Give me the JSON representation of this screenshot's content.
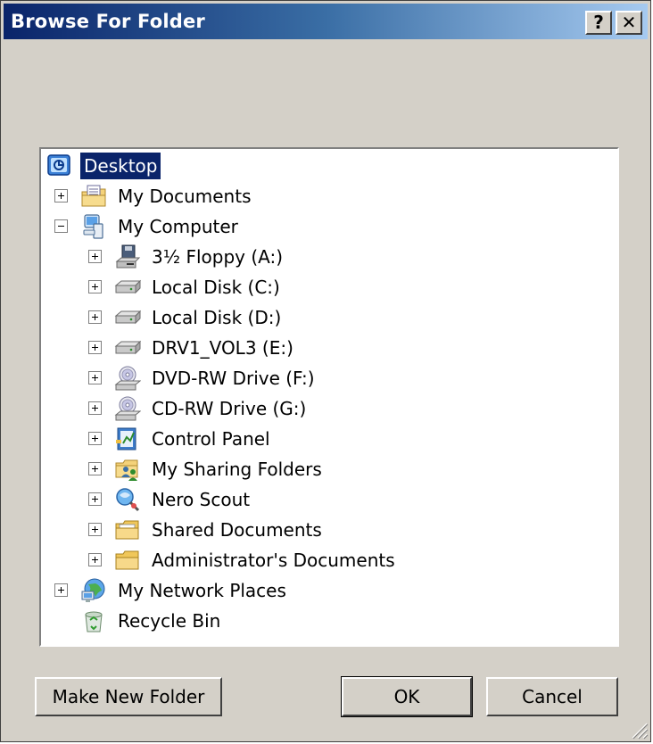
{
  "window": {
    "title": "Browse For Folder",
    "help_label": "?",
    "close_label": "✕"
  },
  "tree": {
    "root": {
      "label": "Desktop",
      "icon": "desktop-icon"
    },
    "items": [
      {
        "label": "My Documents",
        "icon": "my-documents-icon",
        "expander": "plus"
      },
      {
        "label": "My Computer",
        "icon": "my-computer-icon",
        "expander": "minus"
      },
      {
        "label": "3½ Floppy (A:)",
        "icon": "floppy-drive-icon",
        "expander": "plus"
      },
      {
        "label": "Local Disk (C:)",
        "icon": "hard-disk-icon",
        "expander": "plus"
      },
      {
        "label": "Local Disk (D:)",
        "icon": "hard-disk-icon",
        "expander": "plus"
      },
      {
        "label": "DRV1_VOL3 (E:)",
        "icon": "hard-disk-icon",
        "expander": "plus"
      },
      {
        "label": "DVD-RW Drive (F:)",
        "icon": "optical-drive-icon",
        "expander": "plus"
      },
      {
        "label": "CD-RW Drive (G:)",
        "icon": "optical-drive-icon",
        "expander": "plus"
      },
      {
        "label": "Control Panel",
        "icon": "control-panel-icon",
        "expander": "plus"
      },
      {
        "label": "My Sharing Folders",
        "icon": "shared-folder-icon",
        "expander": "plus"
      },
      {
        "label": "Nero Scout",
        "icon": "nero-scout-icon",
        "expander": "plus"
      },
      {
        "label": "Shared Documents",
        "icon": "folder-icon",
        "expander": "plus"
      },
      {
        "label": "Administrator's Documents",
        "icon": "folder-icon",
        "expander": "plus"
      },
      {
        "label": "My Network Places",
        "icon": "network-places-icon",
        "expander": "plus"
      },
      {
        "label": "Recycle Bin",
        "icon": "recycle-bin-icon",
        "expander": "none"
      }
    ]
  },
  "buttons": {
    "make_new_folder": "Make New Folder",
    "ok": "OK",
    "cancel": "Cancel"
  },
  "colors": {
    "title_start": "#0a246a",
    "title_end": "#a6caf0",
    "selection": "#0a246a",
    "face": "#d4d0c8"
  }
}
